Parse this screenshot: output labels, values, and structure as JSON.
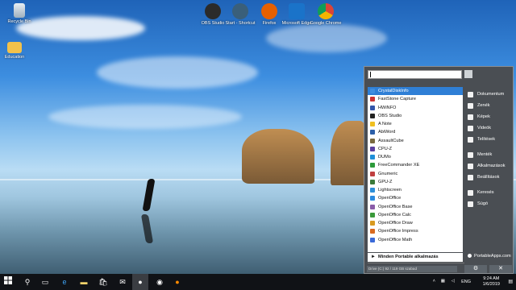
{
  "desktop": {
    "icons_left": [
      {
        "label": "Recycle Bin",
        "icon": "recycle-bin-icon"
      },
      {
        "label": "Education",
        "icon": "folder-icon"
      }
    ],
    "icons_top": [
      {
        "label": "OBS Studio",
        "icon": "obs-icon",
        "color": "#2b2b2b"
      },
      {
        "label": "Start - Shortcut",
        "icon": "start-shortcut-icon",
        "color": "#3a5f7a"
      },
      {
        "label": "Firefox",
        "icon": "firefox-icon",
        "color": "#e66000"
      },
      {
        "label": "Microsoft Edge",
        "icon": "edge-icon",
        "color": "#1a73c9"
      },
      {
        "label": "Google Chrome",
        "icon": "chrome-icon",
        "color": "#db4437"
      }
    ]
  },
  "menu": {
    "search_placeholder": "",
    "apps": [
      {
        "label": "CrystalDiskInfo",
        "icon": "crystaldiskinfo-icon",
        "color": "#3f8ee0",
        "selected": true
      },
      {
        "label": "FastStone Capture",
        "icon": "faststone-icon",
        "color": "#cc3333"
      },
      {
        "label": "HWiNFO",
        "icon": "hwinfo-icon",
        "color": "#3355aa"
      },
      {
        "label": "OBS Studio",
        "icon": "obs-icon",
        "color": "#222222"
      },
      {
        "label": "A Note",
        "icon": "anote-icon",
        "color": "#f0c020"
      },
      {
        "label": "AbiWord",
        "icon": "abiword-icon",
        "color": "#2c5fa8"
      },
      {
        "label": "AssaultCube",
        "icon": "assaultcube-icon",
        "color": "#7a6a40"
      },
      {
        "label": "CPU-Z",
        "icon": "cpuz-icon",
        "color": "#5b3fa0"
      },
      {
        "label": "DUMo",
        "icon": "dumo-icon",
        "color": "#1f8fd8"
      },
      {
        "label": "FreeCommander XE",
        "icon": "freecommander-icon",
        "color": "#2c9a3a"
      },
      {
        "label": "Gnumeric",
        "icon": "gnumeric-icon",
        "color": "#c04040"
      },
      {
        "label": "GPU-Z",
        "icon": "gpuz-icon",
        "color": "#3a7a3a"
      },
      {
        "label": "Lightscreen",
        "icon": "lightscreen-icon",
        "color": "#2d8fd8"
      },
      {
        "label": "OpenOffice",
        "icon": "openoffice-icon",
        "color": "#2a8adf"
      },
      {
        "label": "OpenOffice Base",
        "icon": "ooo-base-icon",
        "color": "#8a5ca8"
      },
      {
        "label": "OpenOffice Calc",
        "icon": "ooo-calc-icon",
        "color": "#3a9a3a"
      },
      {
        "label": "OpenOffice Draw",
        "icon": "ooo-draw-icon",
        "color": "#d89a20"
      },
      {
        "label": "OpenOffice Impress",
        "icon": "ooo-impress-icon",
        "color": "#d86a20"
      },
      {
        "label": "OpenOffice Math",
        "icon": "ooo-math-icon",
        "color": "#3a6ad8"
      }
    ],
    "all_apps_label": "Minden Portable alkalmazás",
    "drive_info": "Drive (C:) 92 / 119 GB szabad",
    "side_items": [
      {
        "label": "Dokumentum",
        "icon": "documents-icon"
      },
      {
        "label": "Zenék",
        "icon": "music-icon"
      },
      {
        "label": "Képek",
        "icon": "pictures-icon"
      },
      {
        "label": "Videók",
        "icon": "videos-icon"
      },
      {
        "label": "Telítések",
        "icon": "downloads-icon"
      },
      {
        "label": "Menték",
        "icon": "backup-icon"
      },
      {
        "label": "Alkalmazások",
        "icon": "apps-icon"
      },
      {
        "label": "Beállítások",
        "icon": "settings-icon"
      },
      {
        "label": "Keresés",
        "icon": "search-icon"
      },
      {
        "label": "Súgó",
        "icon": "help-icon"
      }
    ],
    "brand": "PortableApps.com",
    "close_glyph": "✕",
    "gear_glyph": "⚙"
  },
  "taskbar": {
    "language": "ENG",
    "time": "9:24 AM",
    "date": "1/6/2019"
  }
}
